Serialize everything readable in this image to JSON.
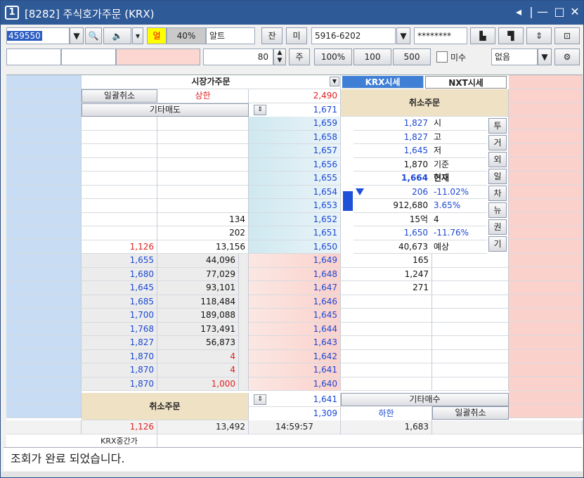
{
  "title": {
    "num": "1",
    "text": "[8282] 주식호가주문 (KRX)"
  },
  "toolbar1": {
    "code": "459550",
    "sell_tag": "얼",
    "pct": "40%",
    "alt": "알트",
    "btn_jan": "잔",
    "btn_mi": "미",
    "account": "5916-6202",
    "password": "********"
  },
  "toolbar2": {
    "qty": "80",
    "ju": "주",
    "p100pct": "100%",
    "q100": "100",
    "q500": "500",
    "misu": "미수",
    "none": "없음"
  },
  "header": {
    "market": "시장가주문",
    "krx": "KRX시세",
    "nxt": "NXT시세",
    "cancel_all": "일괄취소",
    "upper": "상한",
    "upper_price": "2,490",
    "other_sell": "기타매도",
    "sell_top": "1,671",
    "cancel_order": "취소주문"
  },
  "ask_prices": [
    "1,659",
    "1,658",
    "1,657",
    "1,656",
    "1,655",
    "1,654",
    "1,653",
    "1,652",
    "1,651",
    "1,650"
  ],
  "ask_qty": [
    "",
    "",
    "",
    "",
    "",
    "",
    "",
    "134",
    "202",
    "13,156"
  ],
  "ask_left": [
    "",
    "",
    "",
    "",
    "",
    "",
    "",
    "",
    "",
    "1,126"
  ],
  "info": [
    {
      "v": "1,827",
      "l": "시"
    },
    {
      "v": "1,827",
      "l": "고"
    },
    {
      "v": "1,645",
      "l": "저"
    },
    {
      "v": "1,870",
      "l": "기준"
    },
    {
      "v": "1,664",
      "l": "현재"
    },
    {
      "v": "206",
      "l": "-11.02%"
    },
    {
      "v": "912,680",
      "l": "3.65%"
    },
    {
      "v": "15억",
      "l": "4"
    },
    {
      "v": "1,650",
      "l": "-11.76%"
    },
    {
      "v": "40,673",
      "l": "예상"
    }
  ],
  "side_tabs": [
    "투",
    "거",
    "외",
    "일",
    "차",
    "뉴",
    "권",
    "기"
  ],
  "bid_prices": [
    "1,649",
    "1,648",
    "1,647",
    "1,646",
    "1,645",
    "1,644",
    "1,643",
    "1,642",
    "1,641",
    "1,640"
  ],
  "bid_qty": [
    "165",
    "1,247",
    "271",
    "",
    "",
    "",
    "",
    "",
    "",
    ""
  ],
  "trades": [
    {
      "p": "1,655",
      "q": "44,096"
    },
    {
      "p": "1,680",
      "q": "77,029"
    },
    {
      "p": "1,645",
      "q": "93,101"
    },
    {
      "p": "1,685",
      "q": "118,484"
    },
    {
      "p": "1,700",
      "q": "189,088"
    },
    {
      "p": "1,768",
      "q": "173,491"
    },
    {
      "p": "1,827",
      "q": "56,873"
    },
    {
      "p": "1,870",
      "q": "4"
    },
    {
      "p": "1,870",
      "q": "4"
    },
    {
      "p": "1,870",
      "q": "1,000"
    }
  ],
  "footer": {
    "cancel_order": "취소주문",
    "buy_bottom": "1,641",
    "lower_price": "1,309",
    "lower": "하한",
    "other_buy": "기타매수",
    "cancel_all": "일괄취소",
    "left_total": "1,126",
    "sum_qty": "13,492",
    "time": "14:59:57",
    "right_total": "1,683",
    "krx_mid": "KRX중간가"
  },
  "status": "조회가 완료 되었습니다."
}
